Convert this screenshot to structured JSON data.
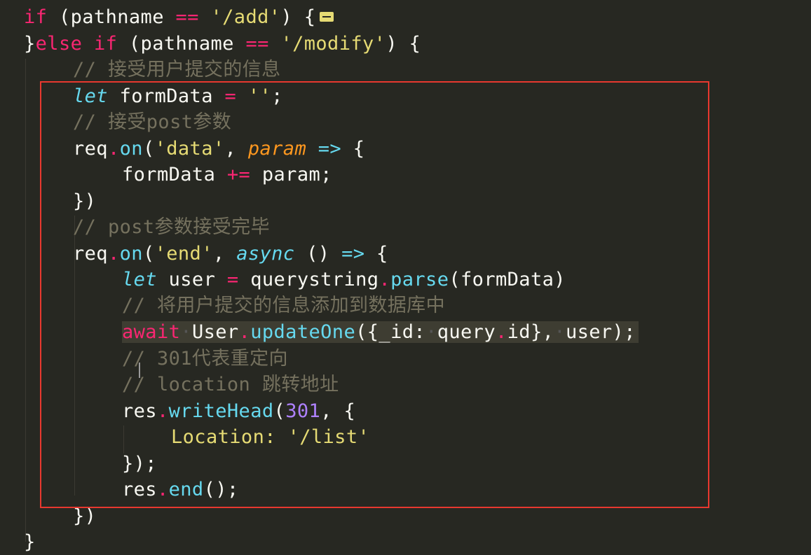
{
  "editor": {
    "theme": "monokai",
    "colors": {
      "background": "#272822",
      "keyword": "#f92672",
      "string": "#e6db74",
      "function": "#66d9ef",
      "parameter": "#fd971f",
      "comment": "#75715e",
      "number": "#ae81ff",
      "highlight_box": "#e8382f"
    },
    "lines": {
      "l1": {
        "kw_if": "if",
        "a": " (pathname ",
        "op": "==",
        "b": " ",
        "str": "'/add'",
        "c": ") {"
      },
      "l2": {
        "brace": "}",
        "kw_else": "else",
        "sp": " ",
        "kw_if": "if",
        "a": " (pathname ",
        "op": "==",
        "b": " ",
        "str": "'/modify'",
        "c": ") {"
      },
      "l3": {
        "comment": "// 接受用户提交的信息"
      },
      "l4": {
        "kw_let": "let",
        "a": " formData ",
        "op": "=",
        "b": " ",
        "str": "''",
        "c": ";"
      },
      "l5": {
        "comment": "// 接受post参数"
      },
      "l6": {
        "a": "req",
        "dot": ".",
        "fn": "on",
        "b": "(",
        "str": "'data'",
        "c": ", ",
        "param": "param",
        "d": " ",
        "arrow": "=>",
        "e": " {"
      },
      "l7": {
        "a": "formData ",
        "op": "+=",
        "b": " param;"
      },
      "l8": {
        "a": "})"
      },
      "l9": {
        "comment": "// post参数接受完毕"
      },
      "l10": {
        "a": "req",
        "dot": ".",
        "fn": "on",
        "b": "(",
        "str": "'end'",
        "c": ", ",
        "kw_async": "async",
        "d": " () ",
        "arrow": "=>",
        "e": " {"
      },
      "l11": {
        "kw_let": "let",
        "a": " user ",
        "op": "=",
        "b": " querystring",
        "dot": ".",
        "fn": "parse",
        "c": "(formData)"
      },
      "l12": {
        "comment": "// 将用户提交的信息添加到数据库中"
      },
      "l13": {
        "kw_await": "await",
        "ws1": "·",
        "a": "User",
        "dot": ".",
        "fn": "updateOne",
        "b": "({_id:",
        "ws2": "·",
        "c": "query",
        "dot2": ".",
        "d": "id},",
        "ws3": "·",
        "e": "user);"
      },
      "l14": {
        "comment": "// 301代表重定向"
      },
      "l15": {
        "comment": "// location 跳转地址"
      },
      "l16": {
        "a": "res",
        "dot": ".",
        "fn": "writeHead",
        "b": "(",
        "num": "301",
        "c": ", {"
      },
      "l17": {
        "key": "Location:",
        "b": " ",
        "str": "'/list'"
      },
      "l18": {
        "a": "});"
      },
      "l19": {
        "a": "res",
        "dot": ".",
        "fn": "end",
        "b": "();"
      },
      "l20": {
        "a": "})"
      },
      "l21": {
        "a": "}"
      }
    }
  }
}
